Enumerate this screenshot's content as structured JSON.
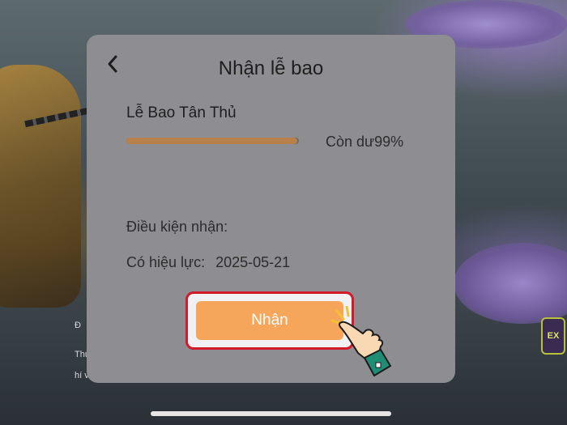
{
  "modal": {
    "title": "Nhận lễ bao",
    "back_icon": "chevron-left-icon"
  },
  "gift_pack": {
    "name": "Lễ Bao Tân Thủ",
    "remaining_text": "Còn dư99%",
    "remaining_percent": 99
  },
  "conditions": {
    "requirement_label": "Điều kiện nhận:",
    "requirement_value": "",
    "validity_label": "Có hiệu lực:",
    "validity_value": "2025-05-21"
  },
  "claim_button": {
    "label": "Nhận",
    "highlight_color": "#d11a2a",
    "fill_color": "#f5a65a"
  },
  "background": {
    "side_text_1": "Đ",
    "side_text_2": "Thử",
    "side_text_3": "hí v",
    "badge_text": "EX"
  },
  "colors": {
    "modal_bg": "#8e8e92",
    "progress_fill": "#b8804a"
  }
}
